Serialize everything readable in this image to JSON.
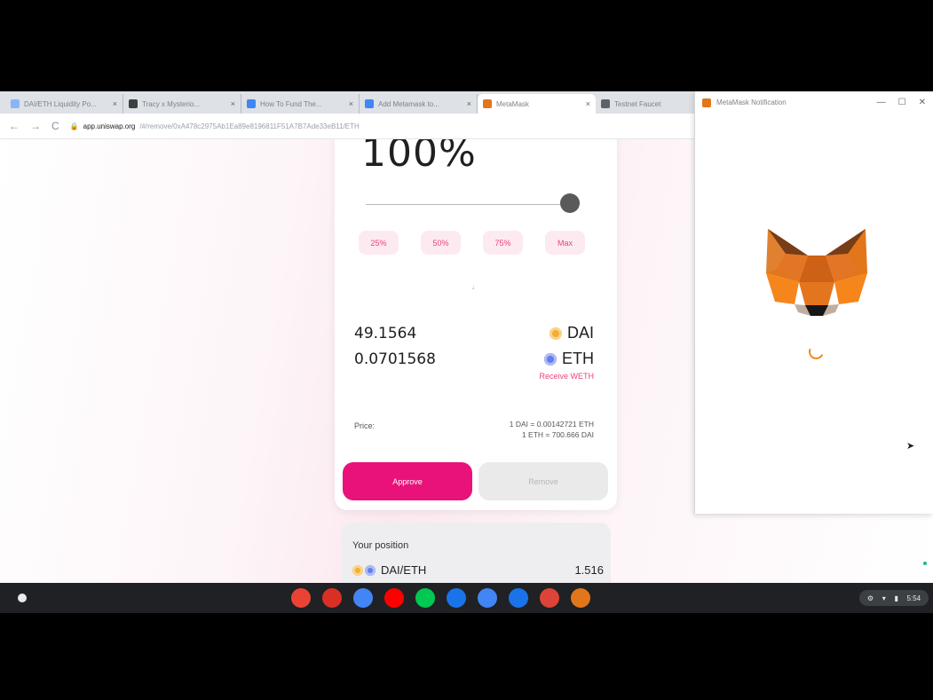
{
  "browser": {
    "tabs": [
      {
        "title": "DAI/ETH Liquidity Po...",
        "color": "#8ab4f8"
      },
      {
        "title": "Tracy x Mysterio...",
        "color": "#3c4043"
      },
      {
        "title": "How To Fund The...",
        "color": "#4285f4"
      },
      {
        "title": "Add Metamask to...",
        "color": "#4285f4"
      },
      {
        "title": "MetaMask",
        "color": "#e2761b",
        "active": true
      },
      {
        "title": "Testnet Faucet",
        "color": "#5f6368"
      }
    ],
    "url_host": "app.uniswap.org",
    "url_rest": "/#/remove/0xA478c2975Ab1Ea89e8196811F51A7B7Ade33eB11/ETH"
  },
  "card": {
    "percent_label": "100%",
    "slider_value": 1.0,
    "pct_buttons": [
      "25%",
      "50%",
      "75%",
      "Max"
    ],
    "arrow": "↓",
    "dai_amount": "49.1564",
    "dai_symbol": "DAI",
    "eth_amount": "0.0701568",
    "eth_symbol": "ETH",
    "receive_link": "Receive WETH",
    "price_label": "Price:",
    "price_line1": "1 DAI = 0.00142721 ETH",
    "price_line2": "1 ETH = 700.666 DAI",
    "approve_label": "Approve",
    "remove_label": "Remove"
  },
  "position": {
    "title": "Your position",
    "pair": "DAI/ETH",
    "value": "1.516"
  },
  "metamask": {
    "title": "MetaMask Notification",
    "minimize": "—",
    "maximize": "☐",
    "close": "✕"
  },
  "shelf": {
    "apps": [
      {
        "name": "chrome",
        "color": "#ea4335"
      },
      {
        "name": "gmail",
        "color": "#d93025"
      },
      {
        "name": "docs",
        "color": "#4285f4"
      },
      {
        "name": "youtube",
        "color": "#ff0000"
      },
      {
        "name": "play-store",
        "color": "#00c853"
      },
      {
        "name": "messages",
        "color": "#1a73e8"
      },
      {
        "name": "screen-cast",
        "color": "#4285f4"
      },
      {
        "name": "chat",
        "color": "#1a73e8"
      },
      {
        "name": "app-red",
        "color": "#db4437"
      },
      {
        "name": "metamask",
        "color": "#e2761b"
      }
    ],
    "time": "5:54"
  }
}
